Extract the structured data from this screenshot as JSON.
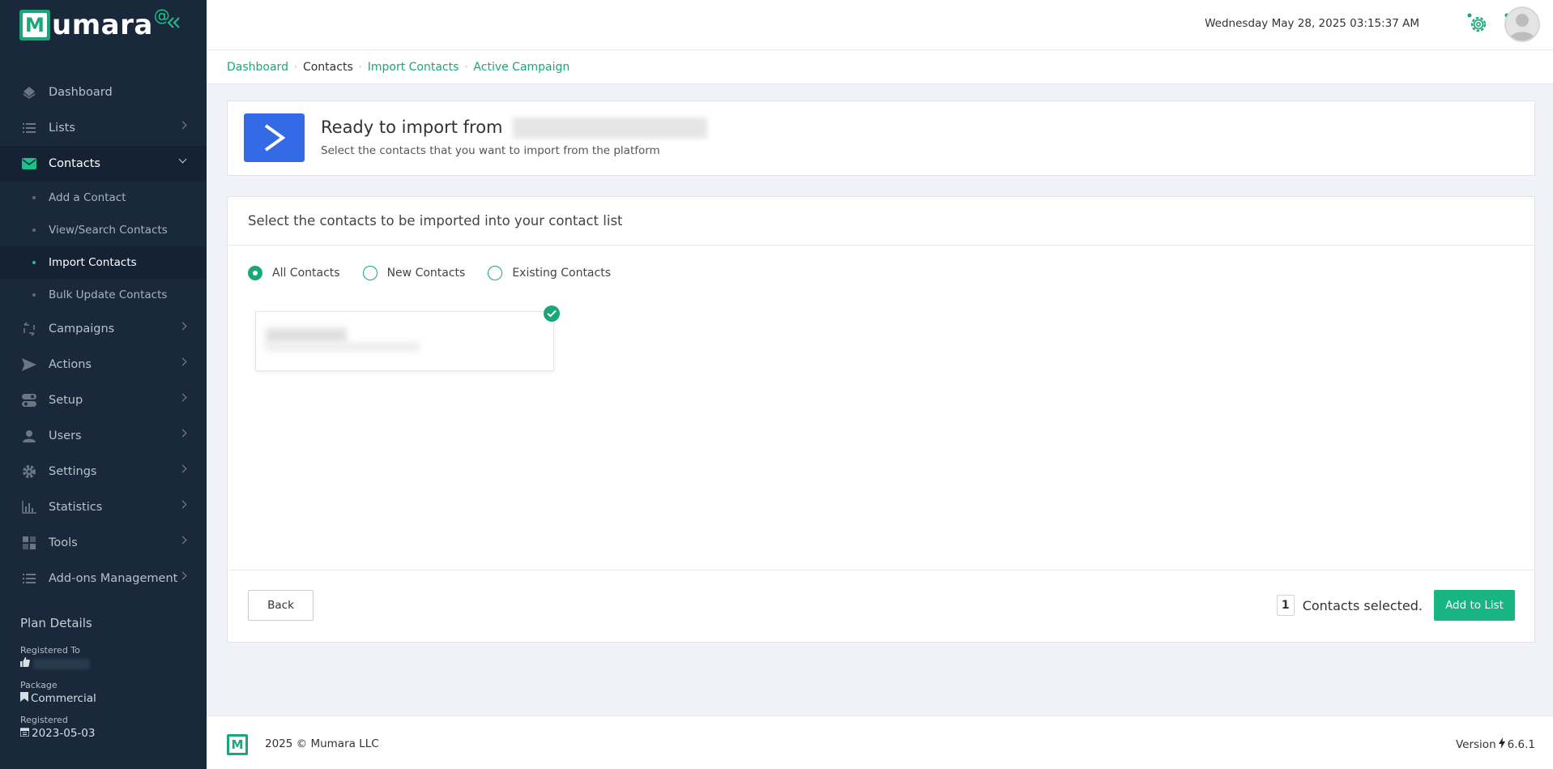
{
  "brand": {
    "logo_letter": "M",
    "name": "umara",
    "at": "@"
  },
  "colors": {
    "accent": "#1aa778",
    "sidebar_bg": "#19293b",
    "active_campaign_blue": "#356ae6",
    "add_button": "#16b582"
  },
  "sidebar": {
    "items": [
      {
        "label": "Dashboard",
        "icon": "dashboard-icon"
      },
      {
        "label": "Lists",
        "icon": "list-icon"
      },
      {
        "label": "Contacts",
        "icon": "envelope-icon"
      },
      {
        "label": "Campaigns",
        "icon": "campaigns-icon"
      },
      {
        "label": "Actions",
        "icon": "send-icon"
      },
      {
        "label": "Setup",
        "icon": "toggle-icon"
      },
      {
        "label": "Users",
        "icon": "user-icon"
      },
      {
        "label": "Settings",
        "icon": "gear-icon"
      },
      {
        "label": "Statistics",
        "icon": "bar-chart-icon"
      },
      {
        "label": "Tools",
        "icon": "grid-icon"
      },
      {
        "label": "Add-ons Management",
        "icon": "list-icon"
      }
    ],
    "contacts_sub": [
      "Add a Contact",
      "View/Search Contacts",
      "Import Contacts",
      "Bulk Update Contacts"
    ],
    "plan": {
      "title": "Plan Details",
      "registered_to_label": "Registered To",
      "package_label": "Package",
      "package_value": "Commercial",
      "registered_label": "Registered",
      "registered_value": "2023-05-03"
    }
  },
  "header": {
    "datetime": "Wednesday May 28, 2025 03:15:37 AM"
  },
  "breadcrumb": [
    "Dashboard",
    "Contacts",
    "Import Contacts",
    "Active Campaign"
  ],
  "import_card": {
    "title": "Ready to import from",
    "subtitle": "Select the contacts that you want to import from the platform"
  },
  "select_card": {
    "heading": "Select the contacts to be imported into your contact list",
    "radios": [
      "All Contacts",
      "New Contacts",
      "Existing Contacts"
    ],
    "selected_radio": "All Contacts",
    "back_label": "Back",
    "selected_count": "1",
    "selected_text": "Contacts selected.",
    "add_label": "Add to List"
  },
  "footer": {
    "copyright": "2025 © Mumara LLC",
    "version_label": "Version",
    "version": "6.6.1"
  }
}
